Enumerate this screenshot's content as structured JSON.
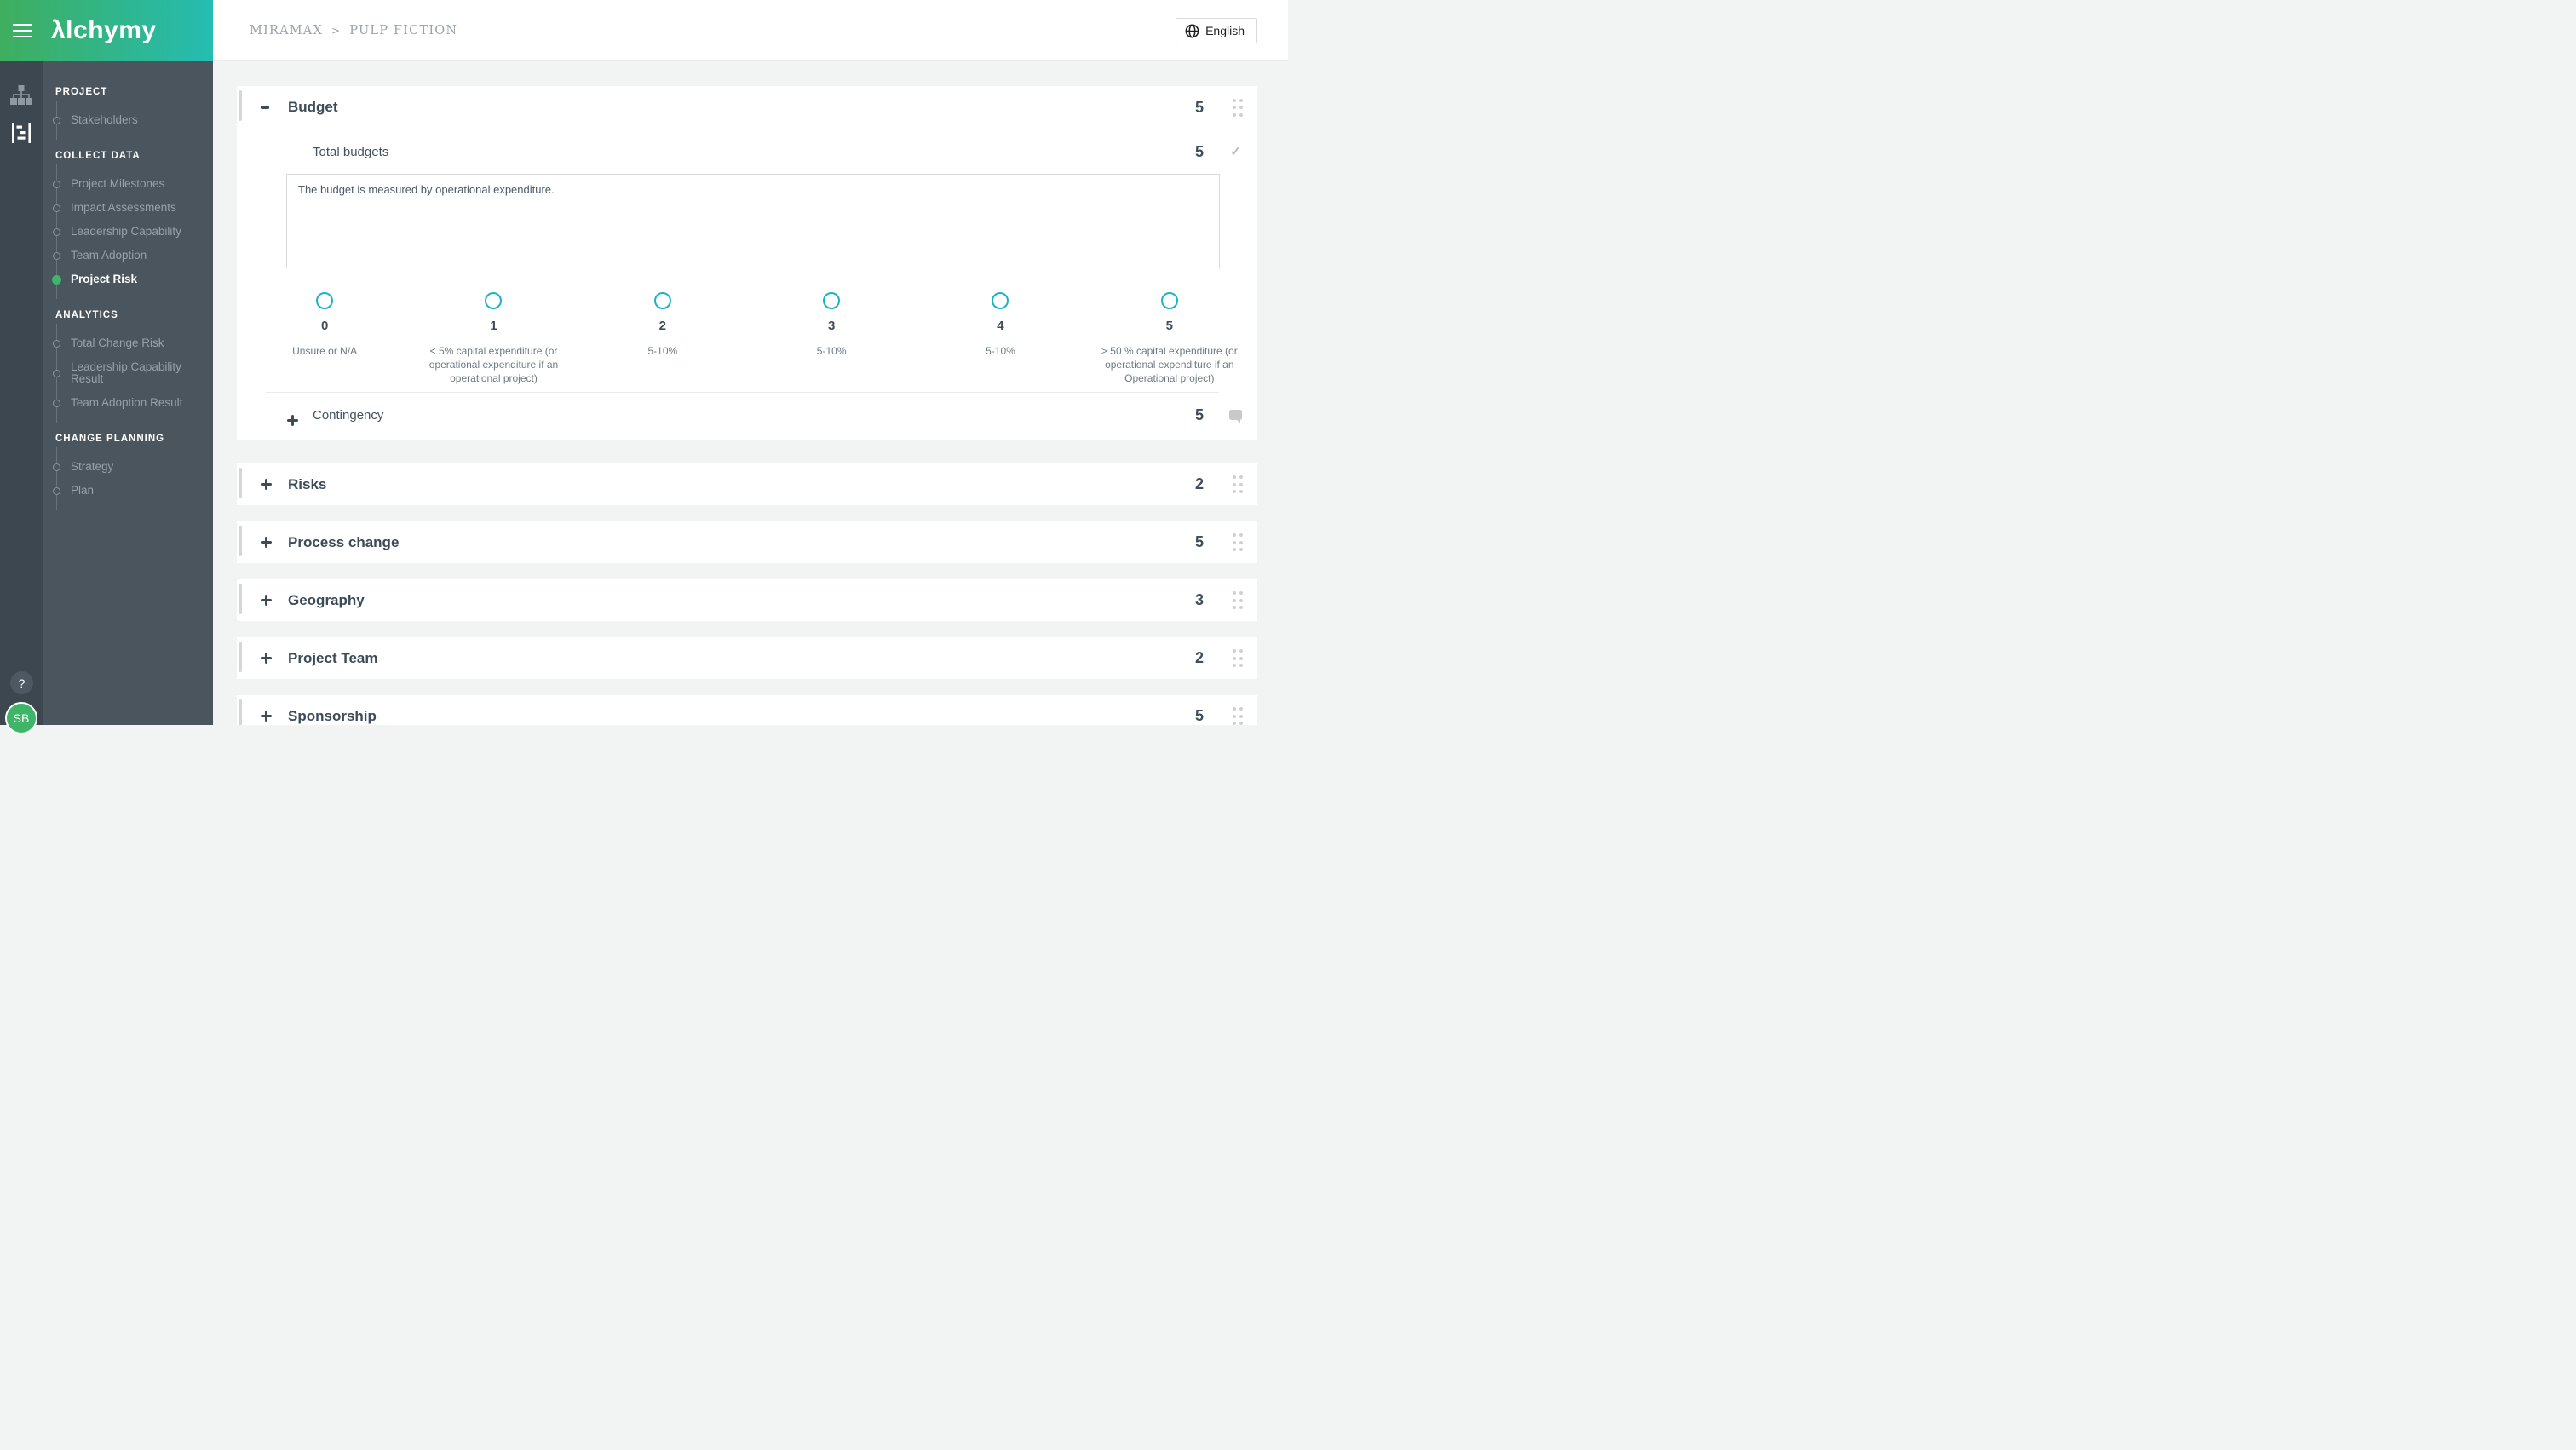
{
  "theme": {
    "gradient_left": "#3fae5e",
    "gradient_right": "#25bcb2",
    "accent_green": "#3fb569",
    "accent_teal": "#1cb4c5",
    "dark_slate": "#3c4c58"
  },
  "header": {
    "logo": "λlchymy",
    "breadcrumb": {
      "parent": "MIRAMAX",
      "separator": ">",
      "current": "PULP FICTION"
    },
    "language": {
      "label": "English"
    }
  },
  "rail": {
    "help_label": "?",
    "avatar_initials": "SB"
  },
  "sidebar": {
    "groups": [
      {
        "heading": "PROJECT",
        "items": [
          {
            "label": "Stakeholders"
          }
        ]
      },
      {
        "heading": "COLLECT DATA",
        "items": [
          {
            "label": "Project Milestones"
          },
          {
            "label": "Impact Assessments"
          },
          {
            "label": "Leadership Capability"
          },
          {
            "label": "Team Adoption"
          },
          {
            "label": "Project Risk",
            "active": true
          }
        ]
      },
      {
        "heading": "ANALYTICS",
        "items": [
          {
            "label": "Total Change Risk"
          },
          {
            "label": "Leadership Capability Result"
          },
          {
            "label": "Team Adoption Result"
          }
        ]
      },
      {
        "heading": "CHANGE PLANNING",
        "items": [
          {
            "label": "Strategy"
          },
          {
            "label": "Plan"
          }
        ]
      }
    ]
  },
  "main": {
    "budget": {
      "title": "Budget",
      "score": "5",
      "total_budgets": {
        "title": "Total budgets",
        "score": "5",
        "note": "The budget is measured by operational expenditure."
      },
      "scale": [
        {
          "value": "0",
          "label": "Unsure or N/A"
        },
        {
          "value": "1",
          "label": "< 5% capital expenditure (or operational expenditure if an operational project)"
        },
        {
          "value": "2",
          "label": "5-10%"
        },
        {
          "value": "3",
          "label": "5-10%"
        },
        {
          "value": "4",
          "label": "5-10%"
        },
        {
          "value": "5",
          "label": "> 50 % capital expenditure (or operational expenditure if an Operational project)"
        }
      ],
      "contingency": {
        "title": "Contingency",
        "score": "5"
      }
    },
    "sections": [
      {
        "title": "Risks",
        "score": "2"
      },
      {
        "title": "Process change",
        "score": "5"
      },
      {
        "title": "Geography",
        "score": "3"
      },
      {
        "title": "Project Team",
        "score": "2"
      },
      {
        "title": "Sponsorship",
        "score": "5"
      }
    ]
  }
}
